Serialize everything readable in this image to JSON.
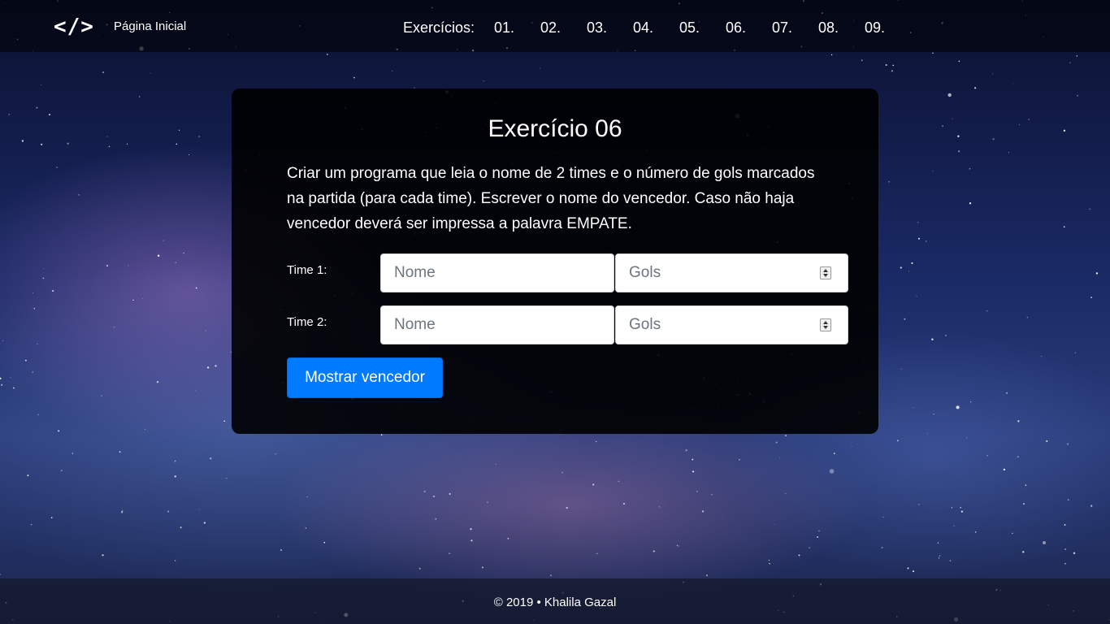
{
  "header": {
    "logo_text": "</>",
    "home_link": "Página Inicial",
    "exercises_label": "Exercícios:",
    "exercise_links": [
      "01.",
      "02.",
      "03.",
      "04.",
      "05.",
      "06.",
      "07.",
      "08.",
      "09."
    ]
  },
  "card": {
    "title": "Exercício 06",
    "description": "Criar um programa que leia o nome de 2 times e o número de gols marcados na partida (para cada time). Escrever o nome do vencedor. Caso não haja vencedor deverá ser impressa a palavra EMPATE.",
    "team1": {
      "label": "Time 1:",
      "name_placeholder": "Nome",
      "goals_placeholder": "Gols",
      "name_value": "",
      "goals_value": ""
    },
    "team2": {
      "label": "Time 2:",
      "name_placeholder": "Nome",
      "goals_placeholder": "Gols",
      "name_value": "",
      "goals_value": ""
    },
    "submit_label": "Mostrar vencedor"
  },
  "footer": {
    "text": "© 2019 • Khalila Gazal"
  },
  "colors": {
    "primary_button": "#007bff",
    "card_background": "#000000",
    "navbar_background": "#000000"
  }
}
